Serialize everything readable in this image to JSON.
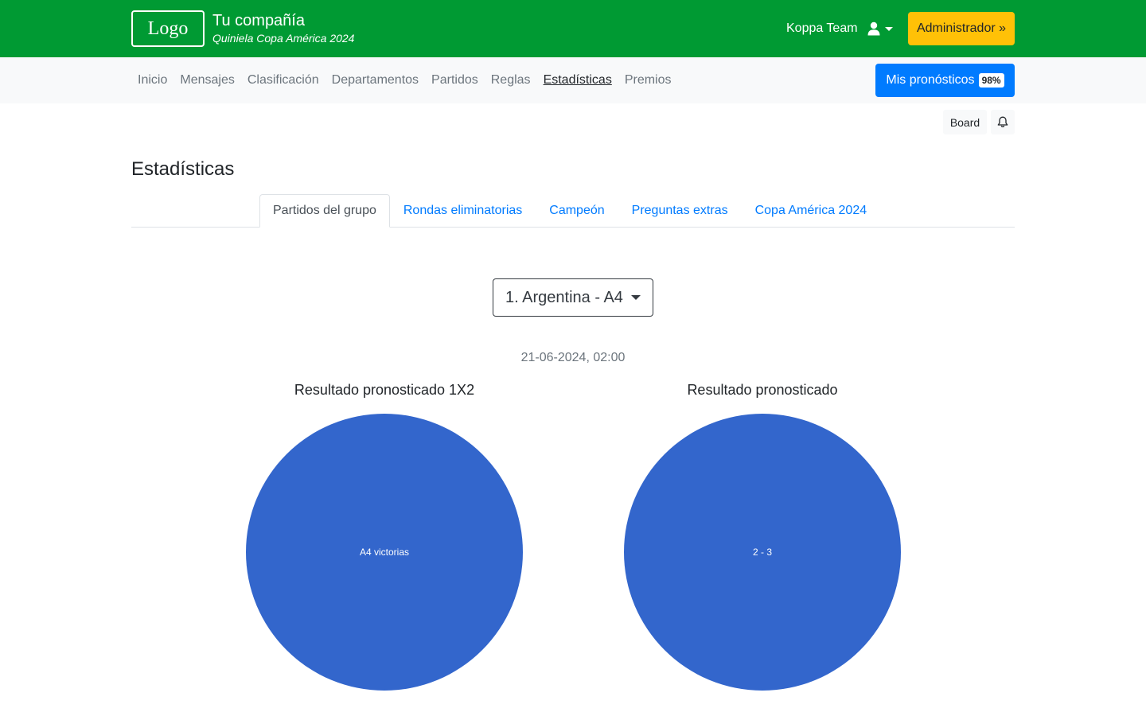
{
  "header": {
    "logo_text": "Logo",
    "company_name": "Tu compañía",
    "company_subtitle": "Quiniela Copa América 2024",
    "user_name": "Koppa Team",
    "admin_label": "Administrador »",
    "brand_color": "#009a33"
  },
  "nav": {
    "items": [
      {
        "label": "Inicio"
      },
      {
        "label": "Mensajes"
      },
      {
        "label": "Clasificación"
      },
      {
        "label": "Departamentos"
      },
      {
        "label": "Partidos"
      },
      {
        "label": "Reglas"
      },
      {
        "label": "Estadísticas",
        "active": true
      },
      {
        "label": "Premios"
      }
    ],
    "mis_pronosticos_label": "Mis pronósticos",
    "mis_pronosticos_badge": "98%"
  },
  "toolbar": {
    "board_label": "Board",
    "bell_icon": "bell-icon"
  },
  "page": {
    "title": "Estadísticas",
    "tabs": [
      {
        "label": "Partidos del grupo",
        "active": true
      },
      {
        "label": "Rondas eliminatorias"
      },
      {
        "label": "Campeón"
      },
      {
        "label": "Preguntas extras"
      },
      {
        "label": "Copa América 2024"
      }
    ],
    "match_select": "1. Argentina - A4",
    "match_date": "21-06-2024, 02:00"
  },
  "chart_data": [
    {
      "type": "pie",
      "title": "Resultado pronosticado 1X2",
      "slices": [
        {
          "label": "A4 victorias",
          "value": 100,
          "color": "#3366cc"
        }
      ]
    },
    {
      "type": "pie",
      "title": "Resultado pronosticado",
      "slices": [
        {
          "label": "2 - 3",
          "value": 100,
          "color": "#3366cc"
        }
      ]
    }
  ]
}
